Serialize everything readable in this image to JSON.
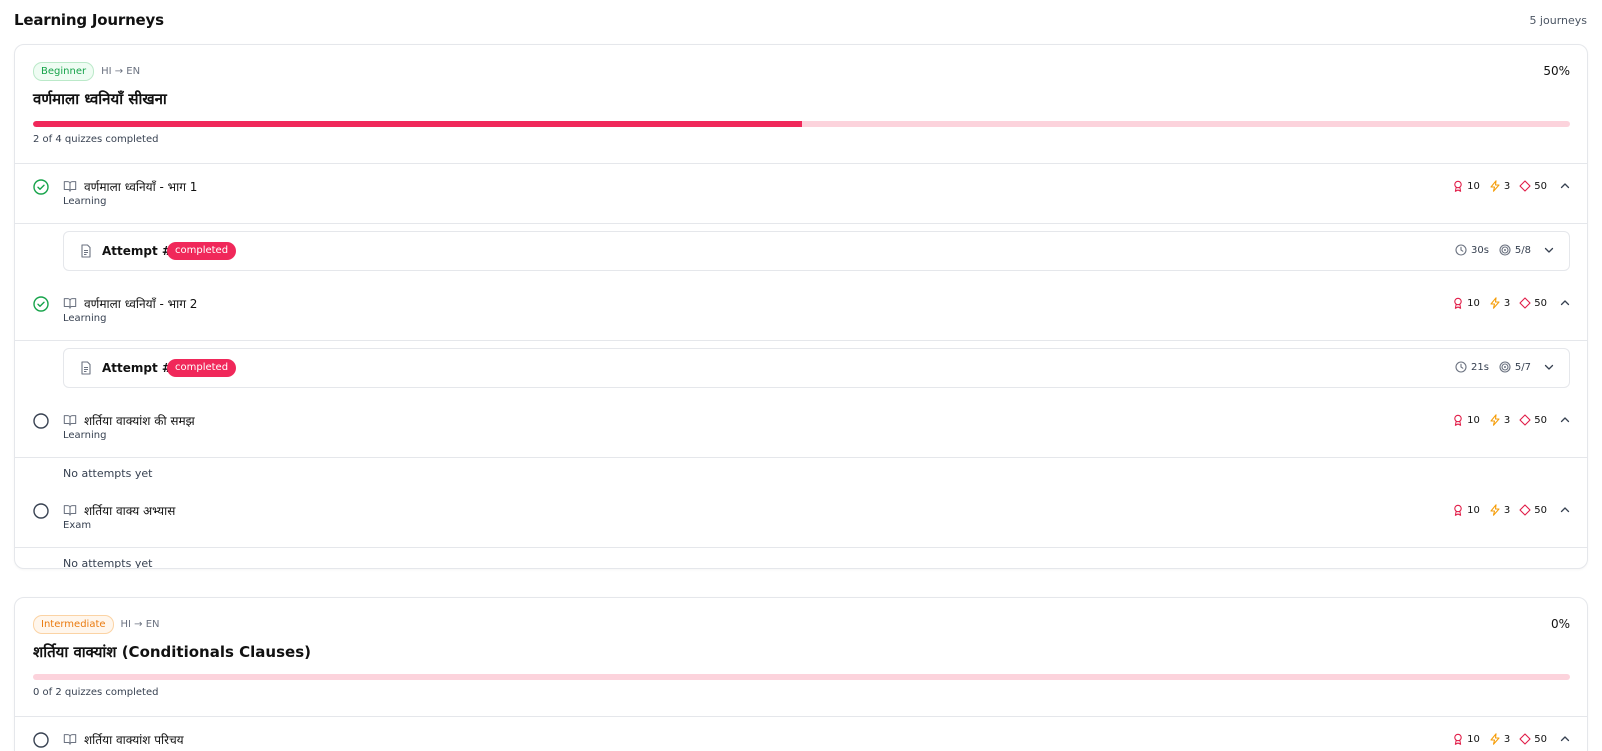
{
  "page": {
    "title": "Learning Journeys",
    "count": "5 journeys"
  },
  "colors": {
    "accent": "#f0285a",
    "success": "#16a34a",
    "beginner": "#16a34a",
    "intermediate": "#ea7b10",
    "reward": "#e11d48",
    "bolt": "#f59e0b"
  },
  "journeys": [
    {
      "level": "Beginner",
      "lang": "HI → EN",
      "percent": "50%",
      "progress_value": 0.5,
      "title": "वर्णमाला ध्वनियाँ सीखना",
      "progress_text": "2 of 4 quizzes completed",
      "quizzes": [
        {
          "title": "वर्णमाला ध्वनियाँ - भाग 1",
          "type": "Learning",
          "status": "completed",
          "points": "10",
          "bolts": "3",
          "gems": "50",
          "attempt": {
            "label": "Attempt #1",
            "status": "completed",
            "time": "30s",
            "score": "5/8"
          }
        },
        {
          "title": "वर्णमाला ध्वनियाँ - भाग 2",
          "type": "Learning",
          "status": "completed",
          "points": "10",
          "bolts": "3",
          "gems": "50",
          "attempt": {
            "label": "Attempt #1",
            "status": "completed",
            "time": "21s",
            "score": "5/7"
          }
        },
        {
          "title": "शर्तिया वाक्यांश की समझ",
          "type": "Learning",
          "status": "pending",
          "points": "10",
          "bolts": "3",
          "gems": "50",
          "empty": "No attempts yet"
        },
        {
          "title": "शर्तिया वाक्य अभ्यास",
          "type": "Exam",
          "status": "pending",
          "points": "10",
          "bolts": "3",
          "gems": "50",
          "empty": "No attempts yet"
        }
      ]
    },
    {
      "level": "Intermediate",
      "lang": "HI → EN",
      "percent": "0%",
      "progress_value": 0,
      "title": "शर्तिया वाक्यांश (Conditionals Clauses)",
      "progress_text": "0 of 2 quizzes completed",
      "quizzes": [
        {
          "title": "शर्तिया वाक्यांश परिचय",
          "type": "",
          "status": "pending",
          "points": "10",
          "bolts": "3",
          "gems": "50"
        }
      ]
    }
  ]
}
